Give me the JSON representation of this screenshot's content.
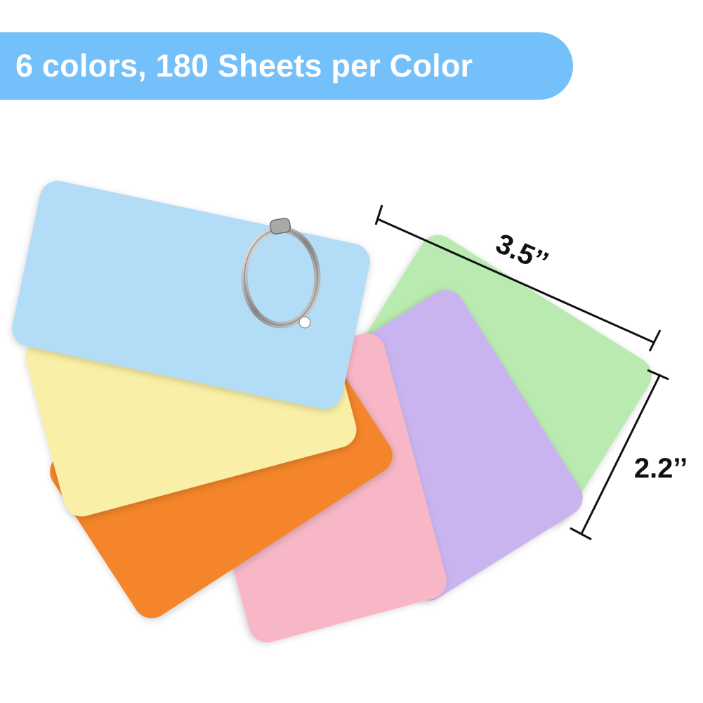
{
  "banner": {
    "text": "6 colors, 180 Sheets per Color"
  },
  "dimensions": {
    "length": "3.5’’",
    "width": "2.2’’"
  },
  "card_colors": {
    "green": "#b9ebb1",
    "purple": "#c9b4ef",
    "pink": "#f8b7c6",
    "orange": "#f4852c",
    "yellow": "#f9efa6",
    "blue": "#b3ddf6"
  },
  "accent_color": "#74c0fa"
}
